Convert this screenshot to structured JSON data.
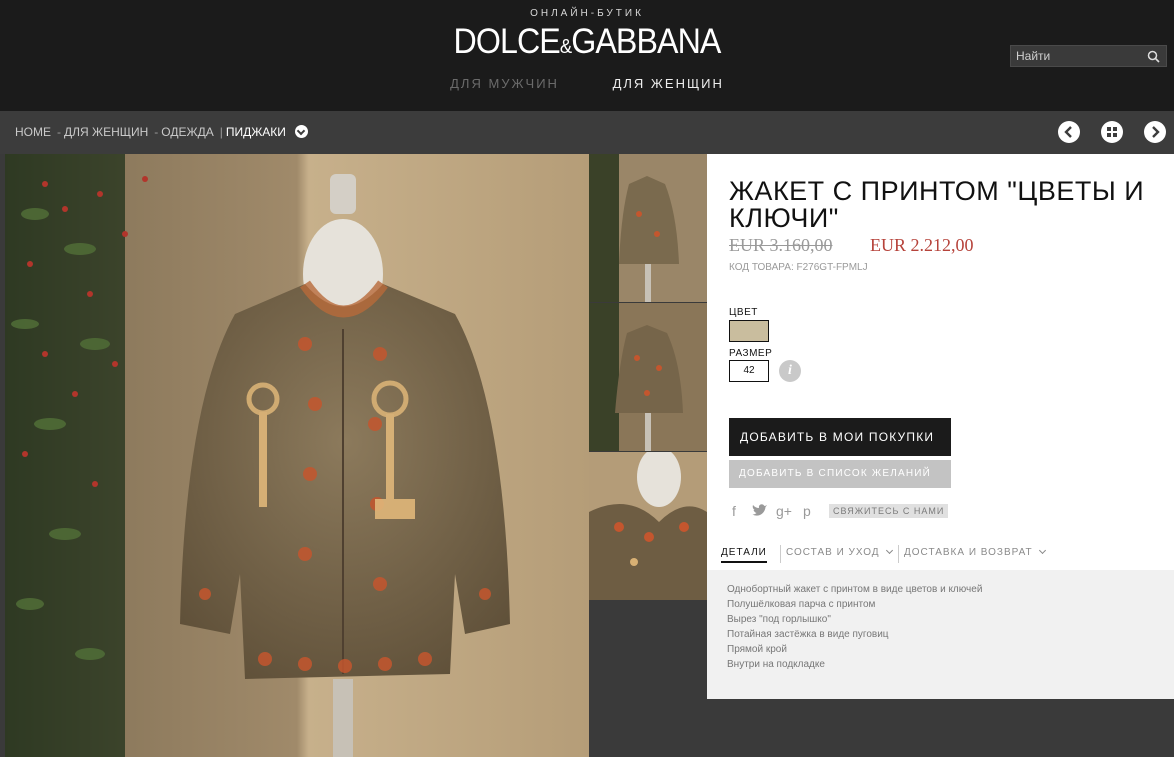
{
  "header": {
    "tagline": "ОНЛАЙН-БУТИК",
    "logo_left": "DOLCE",
    "logo_amp": "&",
    "logo_right": "GABBANA",
    "nav_men": "ДЛЯ МУЖЧИН",
    "nav_women": "ДЛЯ ЖЕНЩИН",
    "search_placeholder": "Найти"
  },
  "breadcrumb": {
    "items": [
      "HOME",
      "ДЛЯ ЖЕНЩИН",
      "ОДЕЖДА"
    ],
    "separator": "-",
    "current": "ПИДЖАКИ"
  },
  "product": {
    "title": "ЖАКЕТ С ПРИНТОМ \"ЦВЕТЫ И КЛЮЧИ\"",
    "old_price": "EUR 3.160,00",
    "new_price": "EUR 2.212,00",
    "sku": "КОД ТОВАРА: F276GT-FPMLJ",
    "color_label": "ЦВЕТ",
    "color_swatch": "#c9bd9e",
    "size_label": "РАЗМЕР",
    "size_value": "42",
    "info_glyph": "i",
    "buy_label": "ДОБАВИТЬ В МОИ ПОКУПКИ",
    "wishlist_label": "ДОБАВИТЬ В СПИСОК ЖЕЛАНИЙ",
    "contact_label": "СВЯЖИТЕСЬ С НАМИ",
    "social": [
      "f",
      "t",
      "g+",
      "p"
    ]
  },
  "tabs": [
    {
      "label": "ДЕТАЛИ",
      "active": true
    },
    {
      "label": "СОСТАВ И УХОД",
      "active": false
    },
    {
      "label": "ДОСТАВКА И ВОЗВРАТ",
      "active": false
    }
  ],
  "details": [
    "Однобортный жакет с принтом в виде цветов и ключей",
    "Полушёлковая парча с принтом",
    "Вырез \"под горлышко\"",
    "Потайная застёжка в виде пуговиц",
    "Прямой крой",
    "Внутри на подкладке"
  ],
  "colors": {
    "header_bg": "#1b1b1b",
    "bar_bg": "#3c3c3c",
    "sale_red": "#b6433b",
    "jacket": "#7d6d52"
  }
}
